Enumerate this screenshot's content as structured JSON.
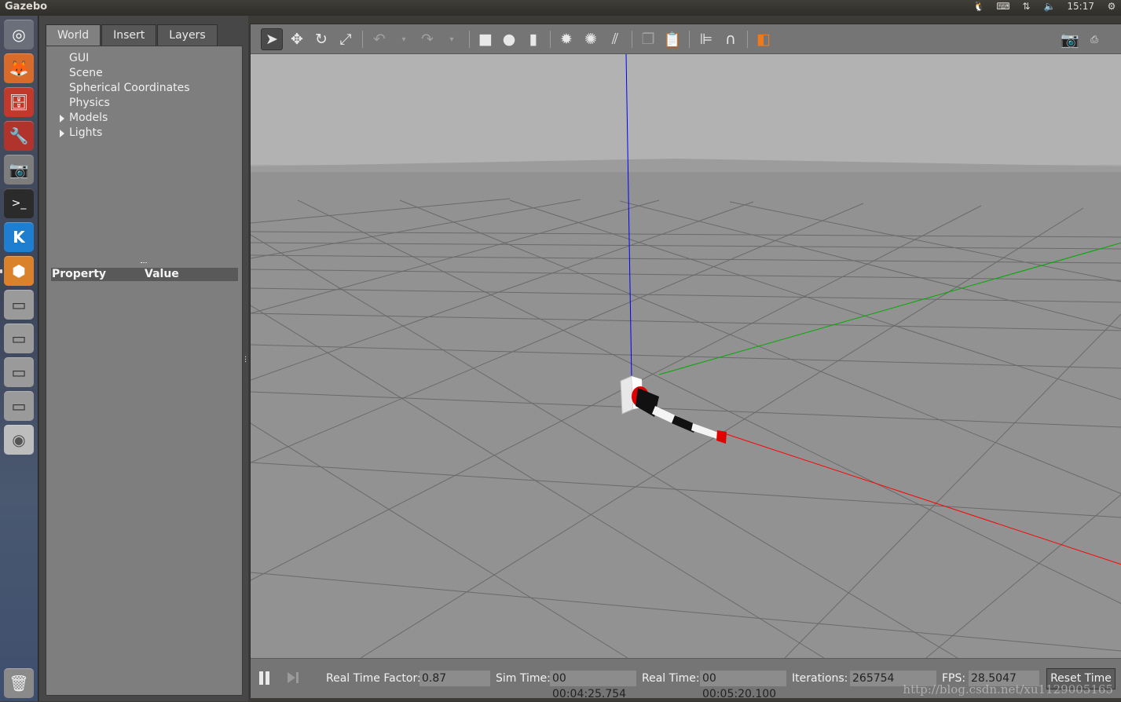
{
  "topbar": {
    "title": "Gazebo",
    "clock": "15:17",
    "indicators": [
      "qq-icon",
      "keyboard-icon",
      "network-icon",
      "volume-icon",
      "settings-gear-icon"
    ]
  },
  "launcher": {
    "items": [
      "dash-home-icon",
      "firefox-icon",
      "files-icon",
      "system-settings-icon",
      "screenshot-icon",
      "terminal-icon",
      "kylin-icon",
      "gazebo-icon",
      "drive-1-icon",
      "drive-2-icon",
      "drive-3-icon",
      "drive-4-icon",
      "dvd-icon",
      "trash-icon"
    ]
  },
  "left_panel": {
    "tabs": [
      "World",
      "Insert",
      "Layers"
    ],
    "active_tab": "World",
    "tree": [
      {
        "label": "GUI",
        "expandable": false
      },
      {
        "label": "Scene",
        "expandable": false
      },
      {
        "label": "Spherical Coordinates",
        "expandable": false
      },
      {
        "label": "Physics",
        "expandable": false
      },
      {
        "label": "Models",
        "expandable": true
      },
      {
        "label": "Lights",
        "expandable": true
      }
    ],
    "property_header": {
      "property": "Property",
      "value": "Value"
    }
  },
  "toolbar": {
    "tools": [
      "select-arrow-icon",
      "translate-icon",
      "rotate-icon",
      "scale-icon",
      "undo-icon",
      "undo-history-icon",
      "redo-icon",
      "redo-history-icon",
      "box-shape-icon",
      "sphere-shape-icon",
      "cylinder-shape-icon",
      "point-light-icon",
      "spot-light-icon",
      "directional-light-icon",
      "copy-icon",
      "paste-icon",
      "align-icon",
      "snap-icon",
      "view-angle-icon",
      "screenshot-icon",
      "log-icon"
    ]
  },
  "statusbar": {
    "real_time_factor_label": "Real Time Factor:",
    "real_time_factor": "0.87",
    "sim_time_label": "Sim Time:",
    "sim_time": "00 00:04:25.754",
    "real_time_label": "Real Time:",
    "real_time": "00 00:05:20.100",
    "iterations_label": "Iterations:",
    "iterations": "265754",
    "fps_label": "FPS:",
    "fps": "28.5047",
    "reset_time_label": "Reset Time"
  },
  "watermark": "http://blog.csdn.net/xu1129005165",
  "colors": {
    "sky": "#b2b2b2",
    "ground": "#929292",
    "z_axis": "#0000ff",
    "y_axis": "#00aa00",
    "x_axis": "#ff0000",
    "robot_red": "#e00000"
  }
}
